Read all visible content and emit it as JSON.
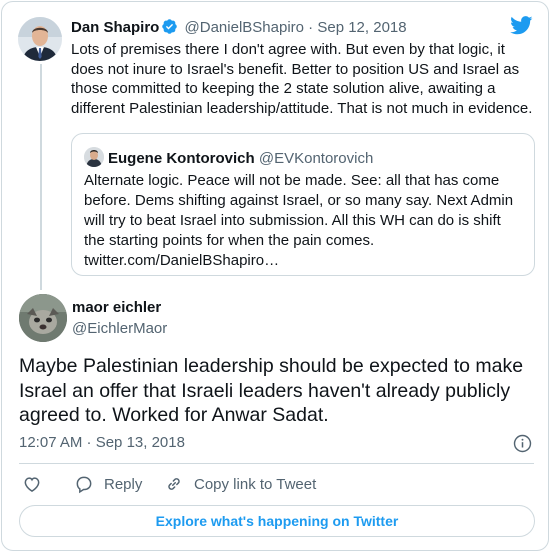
{
  "parent_tweet": {
    "author_name": "Dan Shapiro",
    "handle": "@DanielBShapiro",
    "separator": "·",
    "date": "Sep 12, 2018",
    "text": "Lots of premises there I don't agree with. But even by that logic, it does not inure to Israel's benefit. Better to position US and Israel as those committed to keeping the 2 state solution alive, awaiting a different Palestinian leadership/attitude. That is not much in evidence."
  },
  "quoted_tweet": {
    "author_name": "Eugene Kontorovich",
    "handle": "@EVKontorovich",
    "text": "Alternate logic. Peace will not be made. See: all that has come before. Dems shifting against Israel, or so many say. Next Admin will try to beat Israel into submission. All this WH can do is shift the starting points for when the pain comes.",
    "link": "twitter.com/DanielBShapiro…"
  },
  "main_tweet": {
    "author_name": "maor eichler",
    "handle": "@EichlerMaor",
    "text": "Maybe Palestinian leadership should be expected to make Israel an offer that Israeli leaders haven't already publicly agreed to. Worked for Anwar Sadat.",
    "timestamp": "12:07 AM · Sep 13, 2018"
  },
  "actions": {
    "reply_label": "Reply",
    "copy_link_label": "Copy link to Tweet"
  },
  "explore_button_label": "Explore what's happening on Twitter",
  "colors": {
    "twitter_blue": "#1d9bf0",
    "text_primary": "#0f1419",
    "text_secondary": "#536471",
    "border": "#cfd9de"
  },
  "icons": [
    "twitter-bird-icon",
    "verified-badge-icon",
    "info-icon",
    "heart-icon",
    "reply-icon",
    "link-icon"
  ]
}
